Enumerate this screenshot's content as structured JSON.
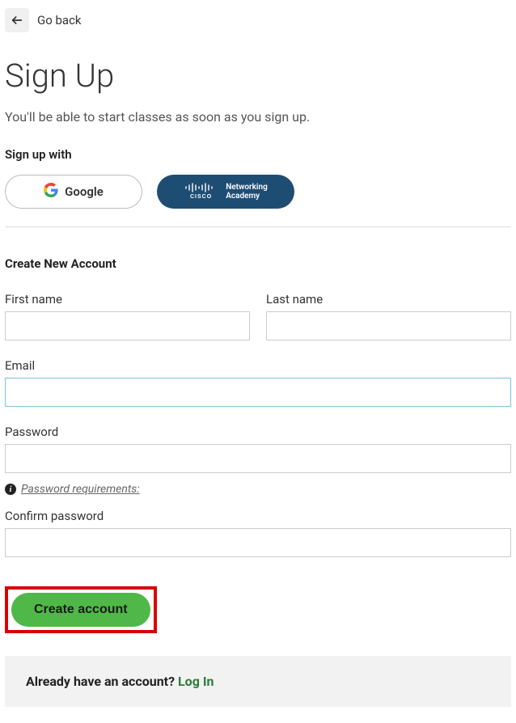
{
  "nav": {
    "go_back": "Go back"
  },
  "header": {
    "title": "Sign Up",
    "subtitle": "You'll be able to start classes as soon as you sign up."
  },
  "oauth": {
    "label": "Sign up with",
    "google": "Google",
    "cisco_line1": "Networking",
    "cisco_line2": "Academy"
  },
  "form": {
    "section_heading": "Create New Account",
    "first_name_label": "First name",
    "first_name_value": "",
    "last_name_label": "Last name",
    "last_name_value": "",
    "email_label": "Email",
    "email_value": "",
    "password_label": "Password",
    "password_value": "",
    "password_req_text": "Password requirements:",
    "confirm_label": "Confirm password",
    "confirm_value": "",
    "submit_label": "Create account"
  },
  "footer": {
    "already_prefix": "Already have an account? ",
    "login": "Log In"
  }
}
